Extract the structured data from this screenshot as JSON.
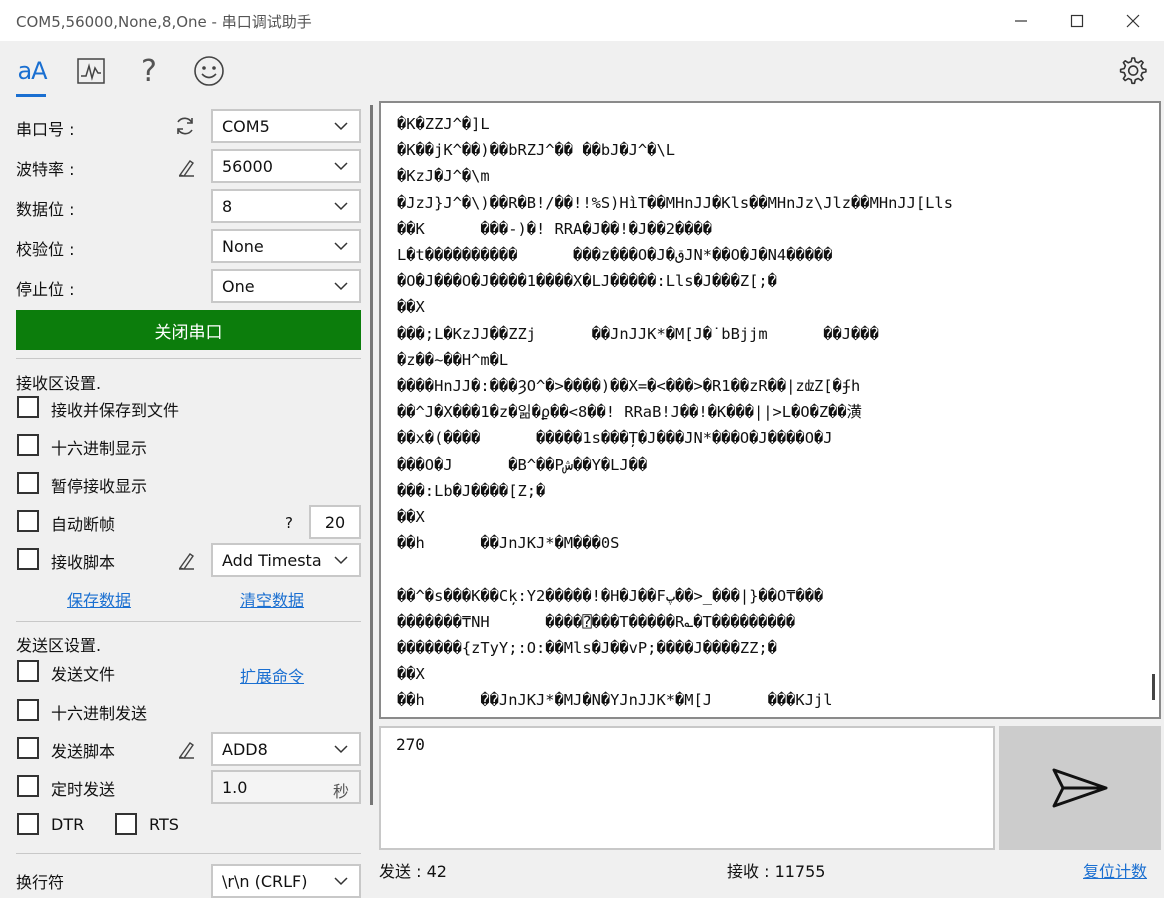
{
  "window": {
    "title": "COM5,56000,None,8,One - 串口调试助手",
    "minimize": "—",
    "maximize": "☐",
    "close": "✕"
  },
  "toolbar": {
    "text_icon": "aA",
    "icons": [
      "text-mode-icon",
      "chart-icon",
      "help-icon",
      "smiley-icon",
      "settings-icon"
    ]
  },
  "serial": {
    "port_label": "串口号 :",
    "port_value": "COM5",
    "baud_label": "波特率 :",
    "baud_value": "56000",
    "databits_label": "数据位 :",
    "databits_value": "8",
    "parity_label": "校验位 :",
    "parity_value": "None",
    "stopbits_label": "停止位 :",
    "stopbits_value": "One",
    "close_button": "关闭串口"
  },
  "receive_settings": {
    "title": "接收区设置.",
    "save_to_file": "接收并保存到文件",
    "hex_display": "十六进制显示",
    "pause_display": "暂停接收显示",
    "auto_frame": "自动断帧",
    "auto_frame_help": "?",
    "auto_frame_value": "20",
    "receive_script": "接收脚本",
    "script_select": "Add Timesta",
    "save_data": "保存数据",
    "clear_data": "清空数据"
  },
  "send_settings": {
    "title": "发送区设置.",
    "send_file": "发送文件",
    "extend_cmd": "扩展命令",
    "hex_send": "十六进制发送",
    "send_script": "发送脚本",
    "send_script_select": "ADD8",
    "timed_send": "定时发送",
    "timed_value": "1.0",
    "timed_unit": "秒",
    "dtr": "DTR",
    "rts": "RTS",
    "newline_label": "换行符",
    "newline_select": "\\r\\n (CRLF)"
  },
  "receive_lines": [
    "�K�ZZJ^�]L",
    "�K��jK^��)��bRZJ^�� ��bJ�J^�\\L",
    "�KzJ�J^�\\m",
    "�JzJ}J^�\\)��R�B!/��!!%S)HìT��MHnJJ�Kls��MHnJz\\Jlz��MHnJJ[Lls",
    "��K      ���-)�! RRA�J��!�J��2����",
    "L�t����������      ���z���O�J�قJN*��O�J�N4�����",
    "�O�J���O�J����1����X�LJ�����:Lls�J���Z[;�",
    "��X",
    "���;L�KzJJ��ZZj      ��JnJJK*�M[J�˙bBjjm      ��J���",
    "�z��~��H^m�L",
    "����HnJJ�:���ȜO^�>����)��X=�<���>�R1��zR��|zǳZ[�ʄh",
    "��^J�X���1�z�읾�ϼ��<8��! RRaB!J��!�K���||>L�O�Z��潢",
    "��x�(����      �����1s���Ț�J���JN*���O�J����O�J",
    "���O�J      �B^��Pش��Y�LJ��",
    "���:Lb�J����[Z;�",
    "��X",
    "��h      ��JnJKJ*�M���0S",
    "",
    "��^�s���K��Cķ:Y2�����!�H�J��Fپ��>_���|}��O₸���",
    "�������₸NH      ����⍰���T�����R؎�T���������",
    "�������{zTyY;:O:��Mls�J��vP;����J����ZZ;�",
    "��X",
    "��h      ��JnJKJ*�MJ�N�YJnJJK*�M[J      ���KJjl"
  ],
  "send_text": "270",
  "status": {
    "sent_label": "发送 : 42",
    "recv_label": "接收 : 11755",
    "reset_link": "复位计数"
  },
  "colors": {
    "accent": "#1a6fd1",
    "close_button_bg": "#0c7d0c",
    "send_button_bg": "#cccccc"
  }
}
